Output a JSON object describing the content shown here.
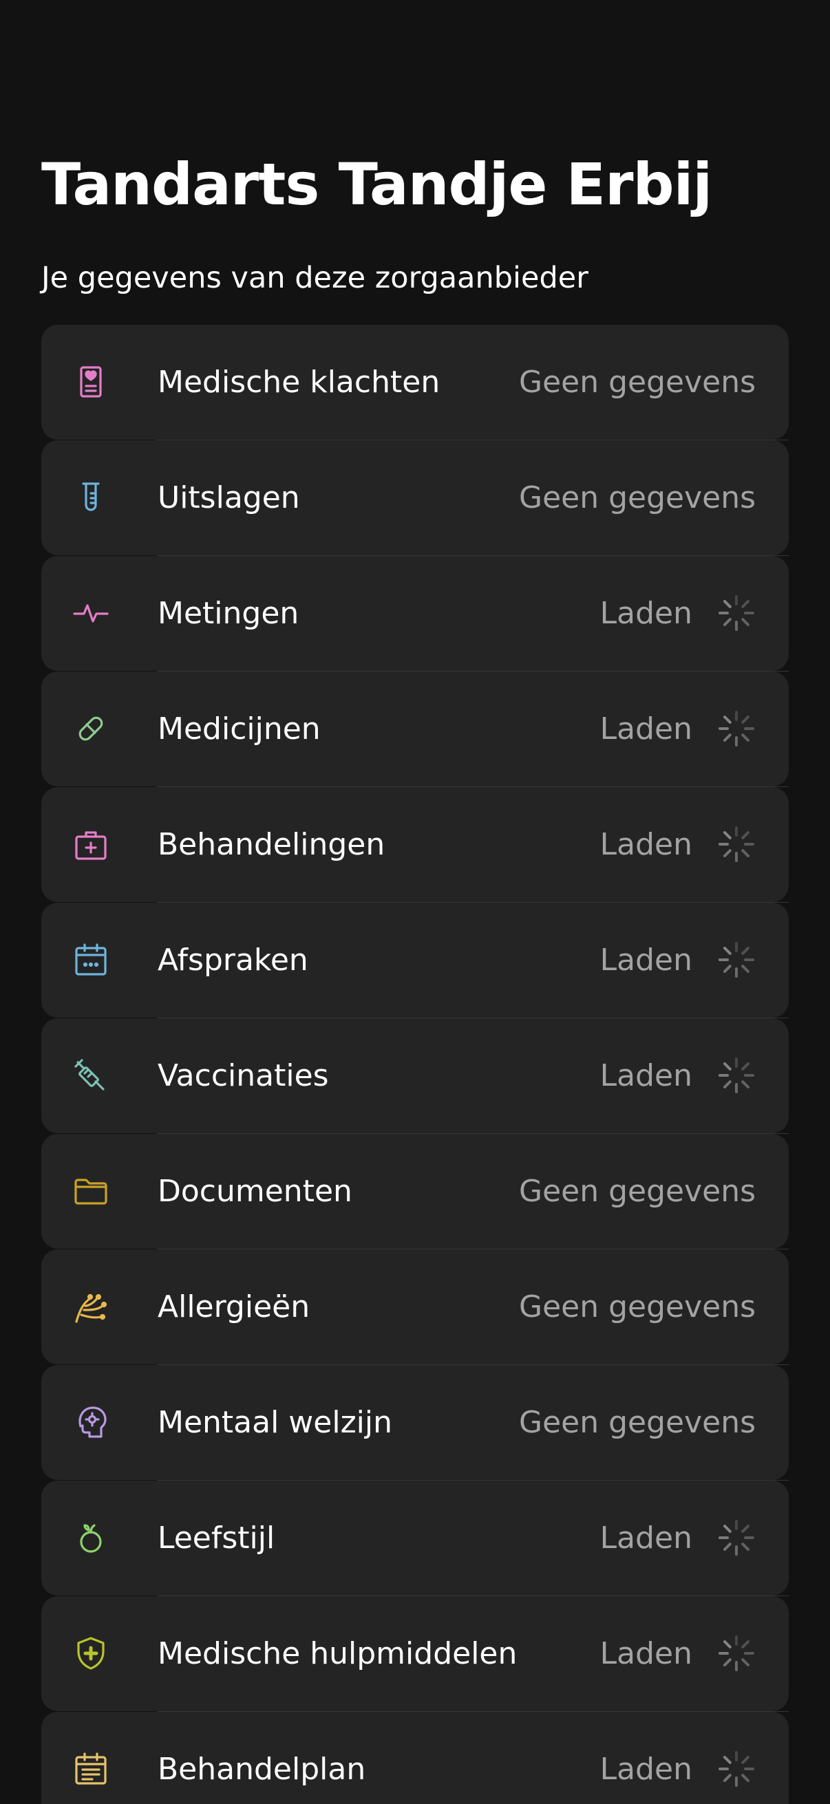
{
  "page": {
    "title": "Tandarts Tandje Erbij",
    "subtitle": "Je gegevens van deze zorgaanbieder"
  },
  "categories": [
    {
      "label": "Medische klachten",
      "status": "Geen gegevens",
      "loading": false,
      "icon": "medical-record-icon",
      "color": "#e57ec8"
    },
    {
      "label": "Uitslagen",
      "status": "Geen gegevens",
      "loading": false,
      "icon": "test-tube-icon",
      "color": "#6fb4dd"
    },
    {
      "label": "Metingen",
      "status": "Laden",
      "loading": true,
      "icon": "pulse-icon",
      "color": "#e57ec8"
    },
    {
      "label": "Medicijnen",
      "status": "Laden",
      "loading": true,
      "icon": "pill-icon",
      "color": "#8ecb8e"
    },
    {
      "label": "Behandelingen",
      "status": "Laden",
      "loading": true,
      "icon": "first-aid-kit-icon",
      "color": "#e57ec8"
    },
    {
      "label": "Afspraken",
      "status": "Laden",
      "loading": true,
      "icon": "calendar-icon",
      "color": "#6fb4dd"
    },
    {
      "label": "Vaccinaties",
      "status": "Laden",
      "loading": true,
      "icon": "syringe-icon",
      "color": "#7cc2b4"
    },
    {
      "label": "Documenten",
      "status": "Geen gegevens",
      "loading": false,
      "icon": "folder-icon",
      "color": "#c9a226"
    },
    {
      "label": "Allergieën",
      "status": "Geen gegevens",
      "loading": false,
      "icon": "pollen-icon",
      "color": "#e7b84b"
    },
    {
      "label": "Mentaal welzijn",
      "status": "Geen gegevens",
      "loading": false,
      "icon": "mind-icon",
      "color": "#b79ae0"
    },
    {
      "label": "Leefstijl",
      "status": "Laden",
      "loading": true,
      "icon": "apple-icon",
      "color": "#8fd36a"
    },
    {
      "label": "Medische hulpmiddelen",
      "status": "Laden",
      "loading": true,
      "icon": "shield-plus-icon",
      "color": "#b8c42a"
    },
    {
      "label": "Behandelplan",
      "status": "Laden",
      "loading": true,
      "icon": "plan-calendar-icon",
      "color": "#e7c46a"
    }
  ]
}
